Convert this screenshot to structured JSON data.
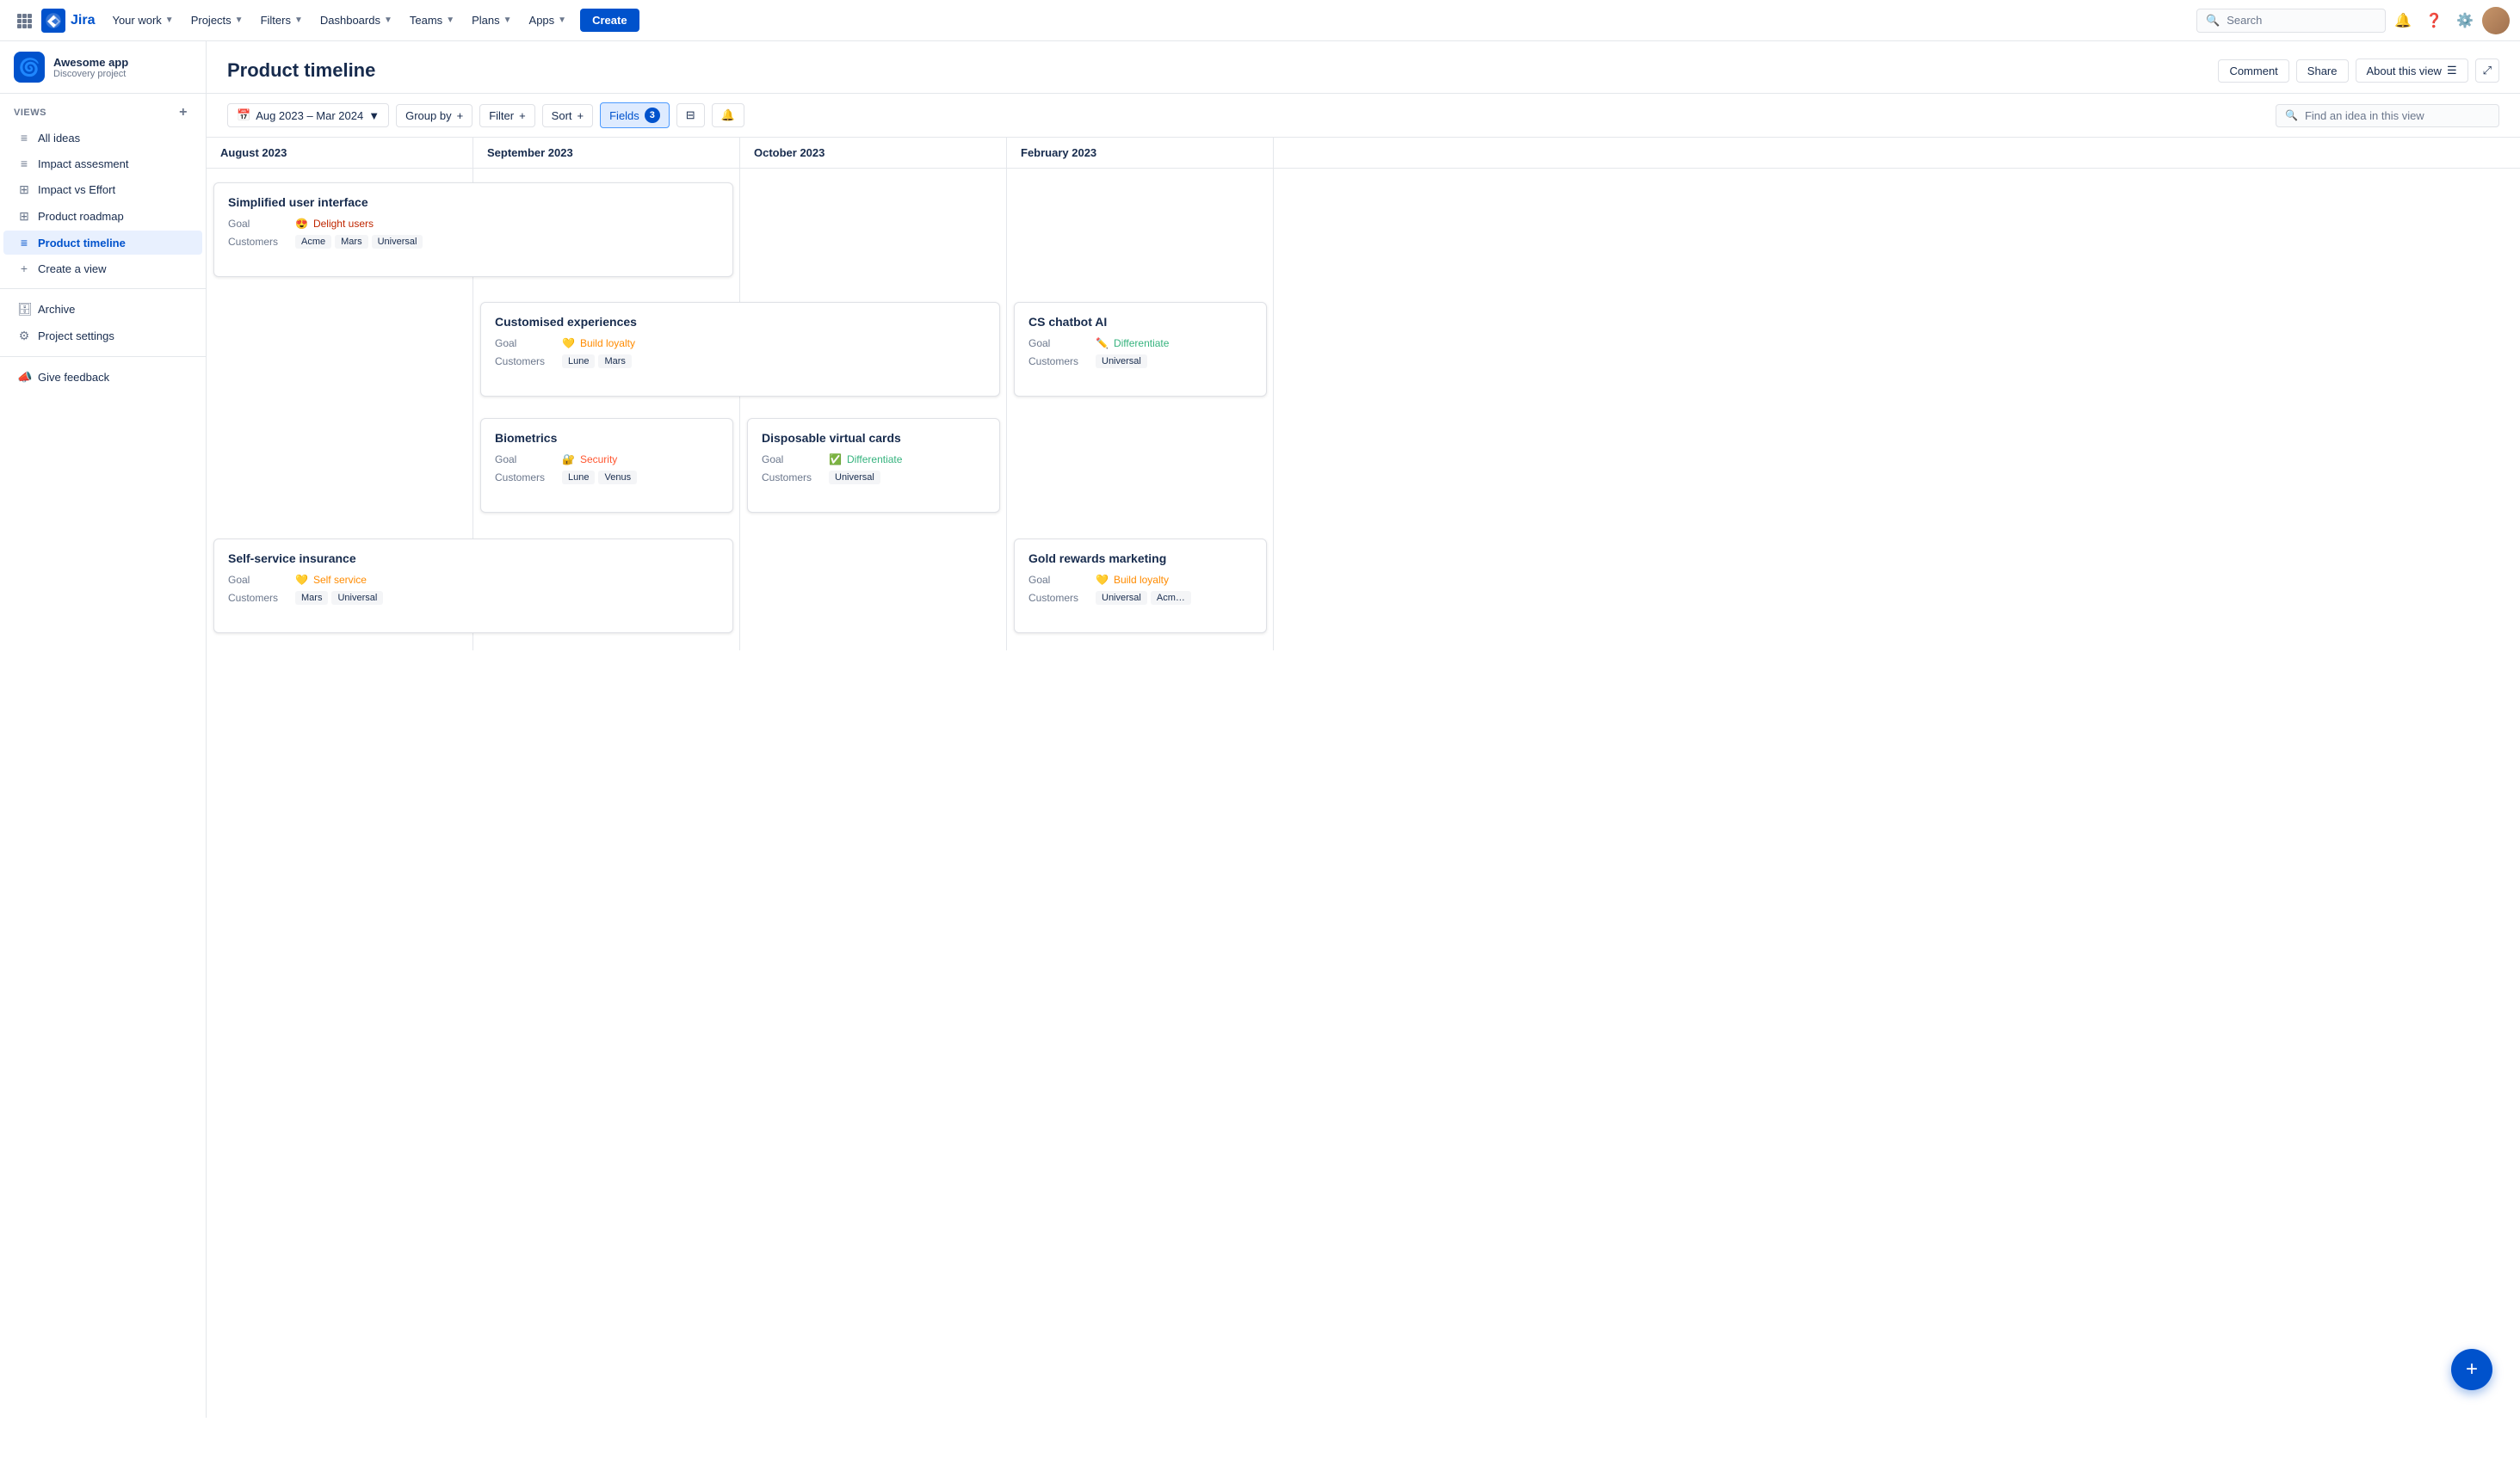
{
  "nav": {
    "logo_text": "Jira",
    "items": [
      {
        "label": "Your work",
        "id": "your-work"
      },
      {
        "label": "Projects",
        "id": "projects"
      },
      {
        "label": "Filters",
        "id": "filters"
      },
      {
        "label": "Dashboards",
        "id": "dashboards"
      },
      {
        "label": "Teams",
        "id": "teams"
      },
      {
        "label": "Plans",
        "id": "plans"
      },
      {
        "label": "Apps",
        "id": "apps"
      }
    ],
    "create_label": "Create",
    "search_placeholder": "Search"
  },
  "sidebar": {
    "project_name": "Awesome app",
    "project_type": "Discovery project",
    "views_label": "VIEWS",
    "nav_items": [
      {
        "label": "All ideas",
        "icon": "≡",
        "id": "all-ideas",
        "active": false
      },
      {
        "label": "Impact assesment",
        "icon": "≡",
        "id": "impact-assessment",
        "active": false
      },
      {
        "label": "Impact vs Effort",
        "icon": "⊞",
        "id": "impact-vs-effort",
        "active": false
      },
      {
        "label": "Product roadmap",
        "icon": "⊞",
        "id": "product-roadmap",
        "active": false
      },
      {
        "label": "Product timeline",
        "icon": "≡",
        "id": "product-timeline",
        "active": true
      },
      {
        "label": "Create a view",
        "icon": "+",
        "id": "create-view",
        "active": false
      }
    ],
    "bottom_items": [
      {
        "label": "Archive",
        "icon": "🗄",
        "id": "archive"
      },
      {
        "label": "Project settings",
        "icon": "⚙",
        "id": "project-settings"
      },
      {
        "label": "Give feedback",
        "icon": "📣",
        "id": "give-feedback"
      }
    ]
  },
  "header": {
    "title": "Product timeline",
    "comment_label": "Comment",
    "share_label": "Share",
    "about_label": "About this view"
  },
  "toolbar": {
    "date_range": "Aug 2023 – Mar 2024",
    "group_by_label": "Group by",
    "filter_label": "Filter",
    "sort_label": "Sort",
    "fields_label": "Fields",
    "fields_count": "3",
    "search_placeholder": "Find an idea in this view"
  },
  "timeline": {
    "months": [
      "August 2023",
      "September 2023",
      "October 2023",
      "February 2023"
    ],
    "cards": [
      {
        "id": "simplified-ui",
        "title": "Simplified user interface",
        "goal_emoji": "😍",
        "goal_text": "Delight users",
        "goal_class": "delight",
        "customers": [
          "Acme",
          "Mars",
          "Universal"
        ],
        "col_start": 0,
        "col_span": 2,
        "row": 0
      },
      {
        "id": "customised-exp",
        "title": "Customised experiences",
        "goal_emoji": "💛",
        "goal_text": "Build loyalty",
        "goal_class": "loyalty",
        "customers": [
          "Lune",
          "Mars"
        ],
        "col_start": 1,
        "col_span": 2,
        "row": 1
      },
      {
        "id": "cs-chatbot",
        "title": "CS chatbot AI",
        "goal_emoji": "✏️",
        "goal_text": "Differentiate",
        "goal_class": "differentiate",
        "customers": [
          "Universal"
        ],
        "col_start": 3,
        "col_span": 1,
        "row": 1
      },
      {
        "id": "biometrics",
        "title": "Biometrics",
        "goal_emoji": "🔐",
        "goal_text": "Security",
        "goal_class": "security",
        "customers": [
          "Lune",
          "Venus"
        ],
        "col_start": 1,
        "col_span": 1,
        "row": 2
      },
      {
        "id": "disposable-cards",
        "title": "Disposable virtual cards",
        "goal_emoji": "✅",
        "goal_text": "Differentiate",
        "goal_class": "differentiate",
        "customers": [
          "Universal"
        ],
        "col_start": 2,
        "col_span": 1,
        "row": 2
      },
      {
        "id": "self-service-insurance",
        "title": "Self-service insurance",
        "goal_emoji": "💛",
        "goal_text": "Self service",
        "goal_class": "self-service",
        "customers": [
          "Mars",
          "Universal"
        ],
        "col_start": 0,
        "col_span": 2,
        "row": 3
      },
      {
        "id": "gold-rewards",
        "title": "Gold rewards marketing",
        "goal_emoji": "💛",
        "goal_text": "Build loyalty",
        "goal_class": "loyalty",
        "customers": [
          "Universal",
          "Acm…"
        ],
        "col_start": 3,
        "col_span": 1,
        "row": 3
      }
    ]
  }
}
